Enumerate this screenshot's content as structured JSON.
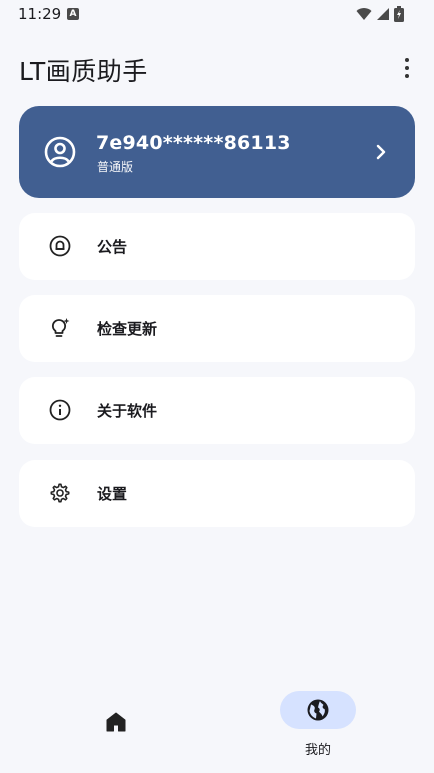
{
  "status_bar": {
    "time": "11:29",
    "notification_icon": "a-letter-icon",
    "icons": [
      "wifi-icon",
      "signal-icon",
      "battery-charging-icon"
    ]
  },
  "app_bar": {
    "title": "LT画质助手",
    "menu_icon": "more-vert-icon"
  },
  "account": {
    "id": "7e940******86113",
    "level": "普通版",
    "icon": "account-circle-icon",
    "chevron_icon": "chevron-right-icon"
  },
  "menu": [
    {
      "label": "公告",
      "icon": "bell-icon"
    },
    {
      "label": "检查更新",
      "icon": "lightbulb-sparkle-icon"
    },
    {
      "label": "关于软件",
      "icon": "info-icon"
    },
    {
      "label": "设置",
      "icon": "gear-icon"
    }
  ],
  "bottom_nav": {
    "home_icon": "home-icon",
    "mine_icon": "globe-icon",
    "mine_label": "我的"
  },
  "colors": {
    "background": "#f6f7fb",
    "accent": "#415f91",
    "nav_indicator": "#d6e2ff",
    "card": "#ffffff"
  }
}
